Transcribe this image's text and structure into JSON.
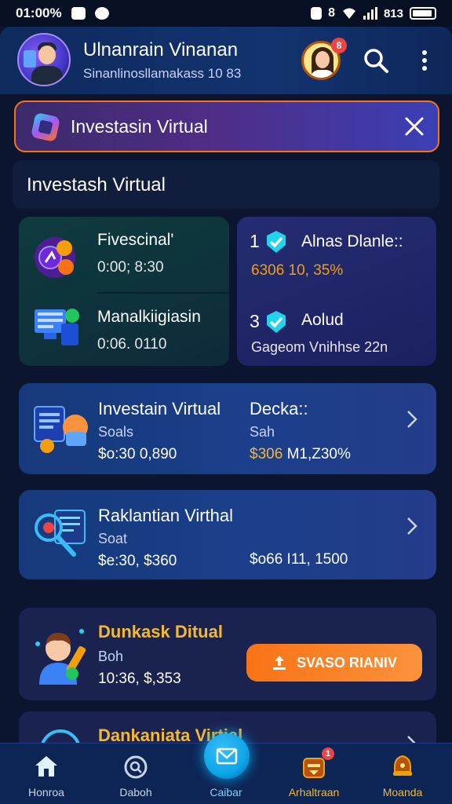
{
  "status_bar": {
    "time": "01:00%",
    "right_text": "813",
    "icons": [
      "notification-icon",
      "app-icon",
      "sim-icon",
      "alarm-icon",
      "wifi-icon",
      "signal-icon",
      "battery-icon"
    ]
  },
  "header": {
    "name": "Ulnanrain Vinanan",
    "subtitle": "Sinanlinosllamakass 10 83",
    "notification_count": "8"
  },
  "banner": {
    "title": "Investasin Virtual",
    "colors": {
      "border": "#f97316",
      "from": "#3b2a6b",
      "to": "#3b3fb5"
    }
  },
  "section": {
    "title": "Investash Virtual"
  },
  "stats": {
    "left": [
      {
        "title": "Fivescinal'",
        "value": "0:00; 8:30",
        "icon": "coins-icon"
      },
      {
        "title": "Manalkiigiasin",
        "value": "0:06. 0110",
        "icon": "monitor-icon"
      }
    ],
    "right": [
      {
        "number": "1",
        "title": "Alnas Dlanle::",
        "value": "6306 10, 35%",
        "icon": "check-badge-icon"
      },
      {
        "number": "3",
        "title": "Aolud",
        "value": "Gageom Vnihhse 22n",
        "icon": "check-badge-icon"
      }
    ]
  },
  "cards": [
    {
      "title": "Investain Virtual",
      "sub_left": "Soals",
      "value_left": "$o:30 0,890",
      "title_right": "Decka::",
      "sub_right": "Sah",
      "value_right_highlight": "$306",
      "value_right_rest": "M1,Z30%",
      "icon": "investment-chart-icon"
    },
    {
      "title": "Raklantian Virthal",
      "sub_left": "Soat",
      "value_left": "$e:30, $360",
      "value_right": "$o66 I11, 1500",
      "icon": "analytics-magnifier-icon"
    }
  ],
  "featured": {
    "title": "Dunkask Ditual",
    "sub": "Boh",
    "value": "10:36, $,353",
    "button_label": "SVASO RIANIV",
    "icon": "person-trophy-icon"
  },
  "partial_card": {
    "title": "Dankaniata Virtial"
  },
  "bottom_nav": [
    {
      "label": "Honroa",
      "icon": "home-icon"
    },
    {
      "label": "Daboh",
      "icon": "search-circle-icon"
    },
    {
      "label": "Caibar",
      "icon": "mail-icon",
      "active": true
    },
    {
      "label": "Arhaltraan",
      "icon": "wallet-icon",
      "badge": "1"
    },
    {
      "label": "Moanda",
      "icon": "bell-icon"
    }
  ],
  "colors": {
    "background": "#0b1530",
    "accent_orange": "#f97316",
    "accent_gold": "#f5b82e",
    "active_nav": "#0ea5e9"
  }
}
